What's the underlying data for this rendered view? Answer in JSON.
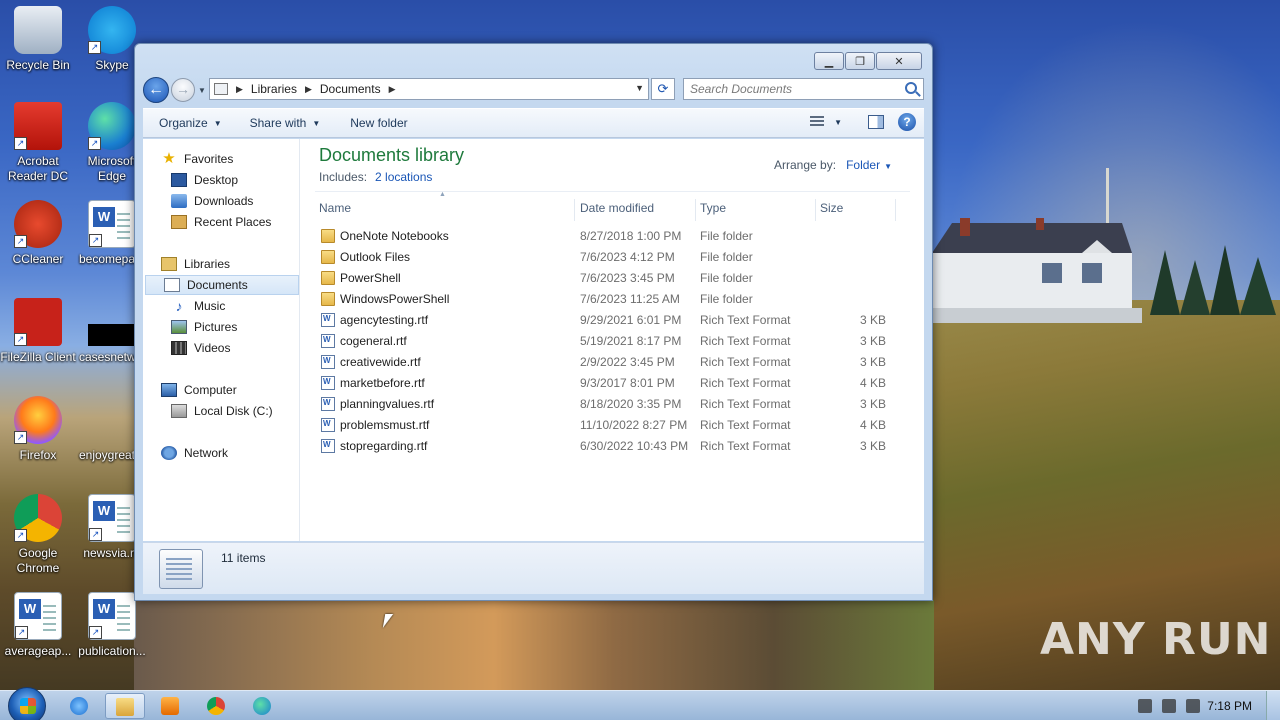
{
  "desktop": {
    "icons": [
      {
        "label": "Recycle Bin",
        "icon": "recycle-bin-icon"
      },
      {
        "label": "Skype",
        "icon": "skype-icon"
      },
      {
        "label": "Acrobat Reader DC",
        "icon": "acrobat-icon"
      },
      {
        "label": "Microsoft Edge",
        "icon": "edge-icon"
      },
      {
        "label": "CCleaner",
        "icon": "ccleaner-icon"
      },
      {
        "label": "becomepa...",
        "icon": "word-doc-icon"
      },
      {
        "label": "FileZilla Client",
        "icon": "filezilla-icon"
      },
      {
        "label": "casesnetw...",
        "icon": "black-file-icon"
      },
      {
        "label": "Firefox",
        "icon": "firefox-icon"
      },
      {
        "label": "enjoygreat...",
        "icon": "blank-icon"
      },
      {
        "label": "Google Chrome",
        "icon": "chrome-icon"
      },
      {
        "label": "newsvia.rtf",
        "icon": "word-doc-icon"
      },
      {
        "label": "averageap...",
        "icon": "word-doc-icon"
      },
      {
        "label": "publication...",
        "icon": "word-doc-icon"
      }
    ],
    "watermark": "ANY RUN"
  },
  "window": {
    "address": {
      "segments": [
        "Libraries",
        "Documents"
      ]
    },
    "search": {
      "placeholder": "Search Documents"
    },
    "toolbar": {
      "organize": "Organize",
      "share_with": "Share with",
      "new_folder": "New folder"
    },
    "nav": {
      "favorites": "Favorites",
      "desktop": "Desktop",
      "downloads": "Downloads",
      "recent_places": "Recent Places",
      "libraries": "Libraries",
      "documents": "Documents",
      "music": "Music",
      "pictures": "Pictures",
      "videos": "Videos",
      "computer": "Computer",
      "local_disk": "Local Disk (C:)",
      "network": "Network"
    },
    "library": {
      "title": "Documents library",
      "includes_label": "Includes:",
      "locations": "2 locations",
      "arrange_label": "Arrange by:",
      "arrange_value": "Folder"
    },
    "columns": {
      "name": "Name",
      "date": "Date modified",
      "type": "Type",
      "size": "Size"
    },
    "files": [
      {
        "name": "OneNote Notebooks",
        "date": "8/27/2018 1:00 PM",
        "type": "File folder",
        "size": "",
        "kind": "folder"
      },
      {
        "name": "Outlook Files",
        "date": "7/6/2023 4:12 PM",
        "type": "File folder",
        "size": "",
        "kind": "folder"
      },
      {
        "name": "PowerShell",
        "date": "7/6/2023 3:45 PM",
        "type": "File folder",
        "size": "",
        "kind": "folder"
      },
      {
        "name": "WindowsPowerShell",
        "date": "7/6/2023 11:25 AM",
        "type": "File folder",
        "size": "",
        "kind": "folder"
      },
      {
        "name": "agencytesting.rtf",
        "date": "9/29/2021 6:01 PM",
        "type": "Rich Text Format",
        "size": "3 KB",
        "kind": "rtf"
      },
      {
        "name": "cogeneral.rtf",
        "date": "5/19/2021 8:17 PM",
        "type": "Rich Text Format",
        "size": "3 KB",
        "kind": "rtf"
      },
      {
        "name": "creativewide.rtf",
        "date": "2/9/2022 3:45 PM",
        "type": "Rich Text Format",
        "size": "3 KB",
        "kind": "rtf"
      },
      {
        "name": "marketbefore.rtf",
        "date": "9/3/2017 8:01 PM",
        "type": "Rich Text Format",
        "size": "4 KB",
        "kind": "rtf"
      },
      {
        "name": "planningvalues.rtf",
        "date": "8/18/2020 3:35 PM",
        "type": "Rich Text Format",
        "size": "3 KB",
        "kind": "rtf"
      },
      {
        "name": "problemsmust.rtf",
        "date": "11/10/2022 8:27 PM",
        "type": "Rich Text Format",
        "size": "4 KB",
        "kind": "rtf"
      },
      {
        "name": "stopregarding.rtf",
        "date": "6/30/2022 10:43 PM",
        "type": "Rich Text Format",
        "size": "3 KB",
        "kind": "rtf"
      }
    ],
    "status": {
      "item_count": "11 items"
    }
  },
  "taskbar": {
    "clock": "7:18 PM",
    "apps": [
      "internet-explorer-icon",
      "explorer-icon",
      "media-player-icon",
      "chrome-icon",
      "edge-icon"
    ]
  }
}
